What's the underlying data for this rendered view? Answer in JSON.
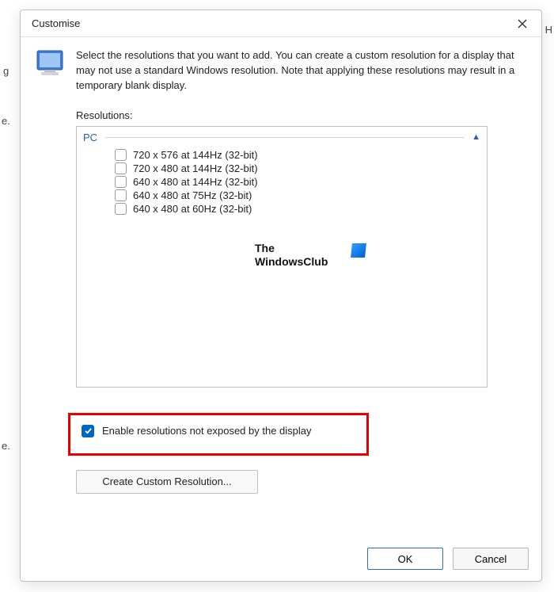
{
  "background_fragments": {
    "g": "g",
    "e": "e.",
    "e2": "e.",
    "nH": "n H"
  },
  "dialog": {
    "title": "Customise",
    "intro": "Select the resolutions that you want to add. You can create a custom resolution for a display that may not use a standard Windows resolution. Note that applying these resolutions may result in a temporary blank display.",
    "list_label": "Resolutions:",
    "group_name": "PC",
    "resolutions": [
      {
        "label": "720 x 576 at 144Hz (32-bit)",
        "checked": false
      },
      {
        "label": "720 x 480 at 144Hz (32-bit)",
        "checked": false
      },
      {
        "label": "640 x 480 at 144Hz (32-bit)",
        "checked": false
      },
      {
        "label": "640 x 480 at 75Hz (32-bit)",
        "checked": false
      },
      {
        "label": "640 x 480 at 60Hz (32-bit)",
        "checked": false
      }
    ],
    "watermark": {
      "line1": "The",
      "line2": "WindowsClub"
    },
    "enable_checkbox": {
      "label": "Enable resolutions not exposed by the display",
      "checked": true
    },
    "create_button": "Create Custom Resolution...",
    "ok_button": "OK",
    "cancel_button": "Cancel"
  }
}
